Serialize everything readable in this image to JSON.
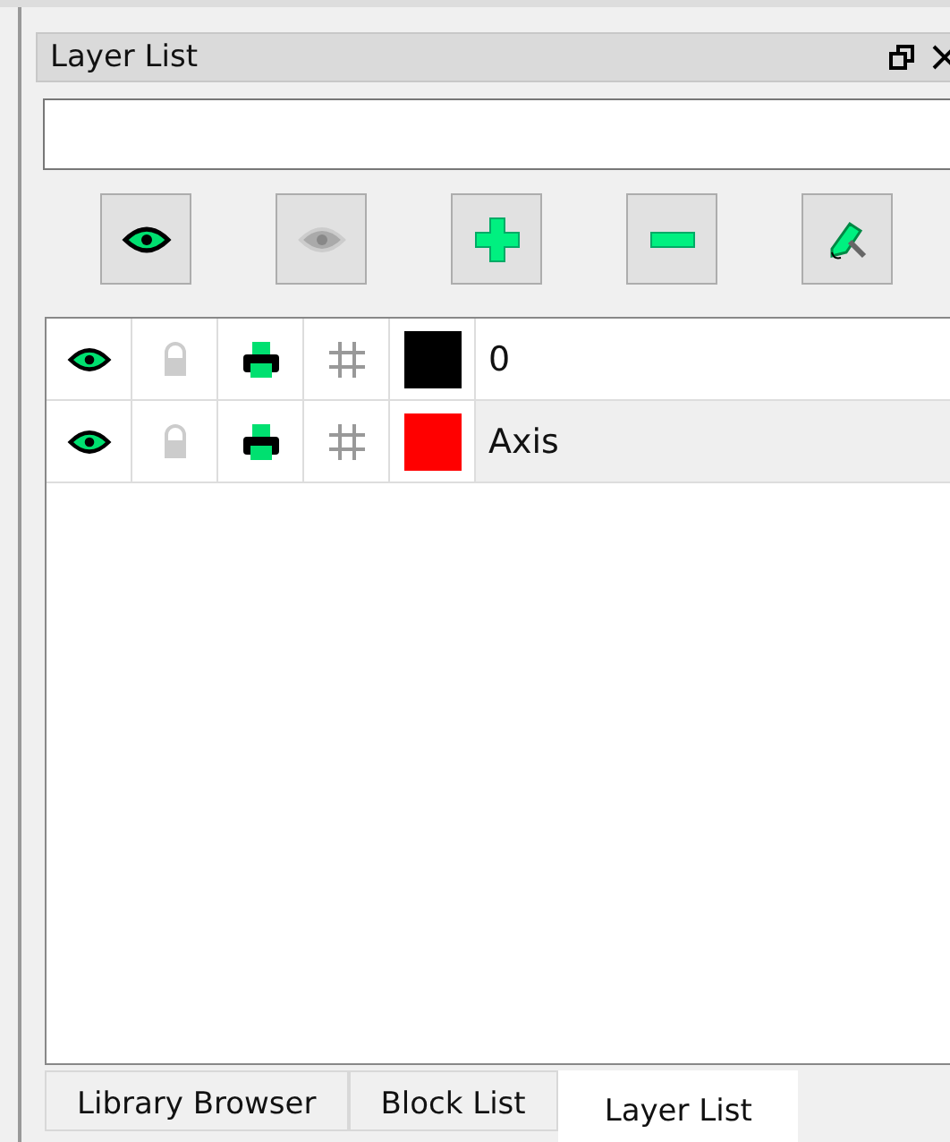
{
  "panel": {
    "title": "Layer List"
  },
  "layers": [
    {
      "name": "0",
      "visible": true,
      "locked": false,
      "printing": true,
      "construction": false,
      "color": "#000000",
      "selected": false
    },
    {
      "name": "Axis",
      "visible": true,
      "locked": false,
      "printing": true,
      "construction": false,
      "color": "#ff0000",
      "selected": true
    }
  ],
  "tabs": [
    {
      "label": "Library Browser",
      "selected": false
    },
    {
      "label": "Block List",
      "selected": false
    },
    {
      "label": "Layer List",
      "selected": true
    }
  ]
}
